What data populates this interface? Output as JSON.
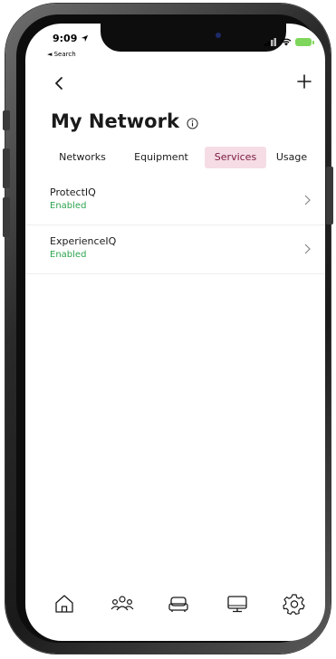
{
  "status_bar": {
    "time": "9:09",
    "back_label": "◄ Search"
  },
  "header": {
    "title": "My Network"
  },
  "tabs": [
    {
      "label": "Networks",
      "active": false
    },
    {
      "label": "Equipment",
      "active": false
    },
    {
      "label": "Services",
      "active": true
    },
    {
      "label": "Usage",
      "active": false
    }
  ],
  "services": [
    {
      "name": "ProtectIQ",
      "status": "Enabled"
    },
    {
      "name": "ExperienceIQ",
      "status": "Enabled"
    }
  ],
  "bottom_nav": [
    {
      "icon": "home-icon"
    },
    {
      "icon": "people-icon"
    },
    {
      "icon": "couch-icon"
    },
    {
      "icon": "monitor-icon"
    },
    {
      "icon": "gear-icon"
    }
  ],
  "colors": {
    "active_tab_bg": "#f5dce5",
    "active_tab_text": "#7a1a3e",
    "status_enabled": "#2ea44f",
    "battery": "#7fd65c"
  }
}
